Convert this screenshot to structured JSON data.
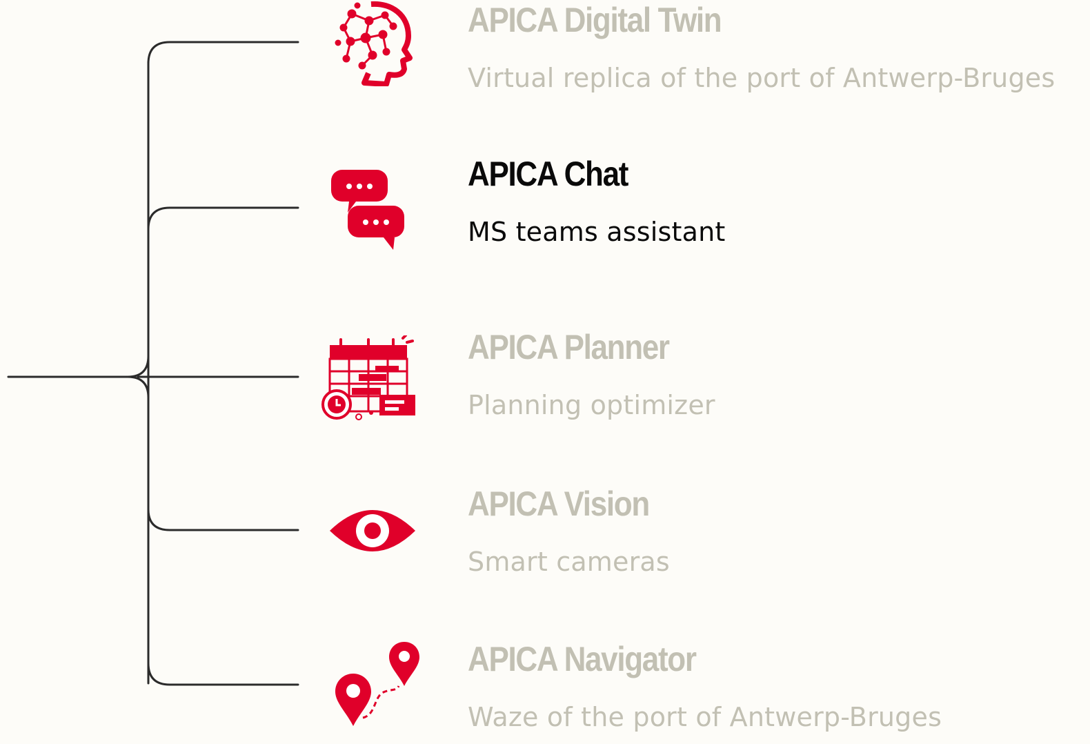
{
  "colors": {
    "background": "#fdfcf8",
    "accent": "#e0002a",
    "muted_text": "#c2c0b3",
    "active_text": "#0a0a0a",
    "connector": "#2b2b2b"
  },
  "items": [
    {
      "icon": "ai-head-icon",
      "title": "APICA Digital Twin",
      "subtitle": "Virtual replica of the port of Antwerp-Bruges",
      "state": "muted"
    },
    {
      "icon": "chat-bubbles-icon",
      "title": "APICA Chat",
      "subtitle": "MS teams assistant",
      "state": "active"
    },
    {
      "icon": "calendar-planner-icon",
      "title": "APICA Planner",
      "subtitle": "Planning optimizer",
      "state": "muted"
    },
    {
      "icon": "eye-icon",
      "title": "APICA Vision",
      "subtitle": "Smart cameras",
      "state": "muted"
    },
    {
      "icon": "route-pins-icon",
      "title": "APICA Navigator",
      "subtitle": "Waze of the port of Antwerp-Bruges",
      "state": "muted"
    }
  ]
}
